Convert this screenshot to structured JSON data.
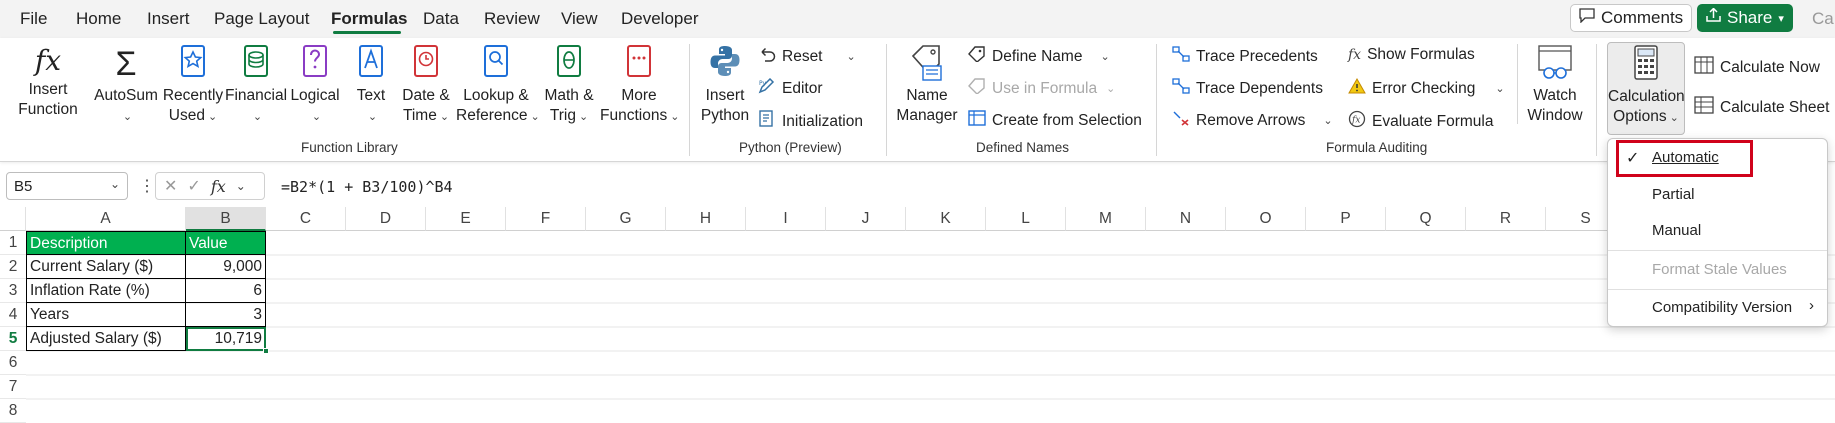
{
  "menu": {
    "tabs": [
      "File",
      "Home",
      "Insert",
      "Page Layout",
      "Formulas",
      "Data",
      "Review",
      "View",
      "Developer"
    ],
    "active_tab": "Formulas",
    "comments_label": "Comments",
    "share_label": "Share",
    "cut_text": "Ca"
  },
  "ribbon": {
    "function_library": {
      "insert_function": [
        "Insert",
        "Function"
      ],
      "autosum": "AutoSum",
      "recently_used": [
        "Recently",
        "Used"
      ],
      "financial": "Financial",
      "logical": "Logical",
      "text": "Text",
      "date_time": [
        "Date &",
        "Time"
      ],
      "lookup": [
        "Lookup &",
        "Reference"
      ],
      "math": [
        "Math &",
        "Trig"
      ],
      "more": [
        "More",
        "Functions"
      ],
      "group_label": "Function Library"
    },
    "python": {
      "insert_python": [
        "Insert",
        "Python"
      ],
      "reset": "Reset",
      "editor": "Editor",
      "initialization": "Initialization",
      "group_label": "Python (Preview)"
    },
    "defined_names": {
      "name_manager": [
        "Name",
        "Manager"
      ],
      "define_name": "Define Name",
      "use_in_formula": "Use in Formula",
      "create_from_selection": "Create from Selection",
      "group_label": "Defined Names"
    },
    "formula_auditing": {
      "trace_precedents": "Trace Precedents",
      "trace_dependents": "Trace Dependents",
      "remove_arrows": "Remove Arrows",
      "show_formulas": "Show Formulas",
      "error_checking": "Error Checking",
      "evaluate_formula": "Evaluate Formula",
      "watch_window": [
        "Watch",
        "Window"
      ],
      "group_label": "Formula Auditing"
    },
    "calculation": {
      "calc_options": [
        "Calculation",
        "Options"
      ],
      "calculate_now": "Calculate Now",
      "calculate_sheet": "Calculate Sheet"
    }
  },
  "formula_bar": {
    "name_box": "B5",
    "formula": "=B2*(1 + B3/100)^B4"
  },
  "sheet": {
    "columns": [
      "A",
      "B",
      "C",
      "D",
      "E",
      "F",
      "G",
      "H",
      "I",
      "J",
      "K",
      "L",
      "M",
      "N",
      "O",
      "P",
      "Q",
      "R",
      "S"
    ],
    "rows": [
      "1",
      "2",
      "3",
      "4",
      "5",
      "6",
      "7",
      "8"
    ],
    "selected_cell": "B5",
    "cells": [
      {
        "a": "Description",
        "b": "Value"
      },
      {
        "a": "Current Salary ($)",
        "b": "9,000"
      },
      {
        "a": "Inflation Rate (%)",
        "b": "6"
      },
      {
        "a": "Years",
        "b": "3"
      },
      {
        "a": "Adjusted Salary ($)",
        "b": "10,719"
      }
    ]
  },
  "calc_dropdown": {
    "automatic": "Automatic",
    "partial": "Partial",
    "manual": "Manual",
    "format_stale": "Format Stale Values",
    "compat": "Compatibility Version",
    "checked": "Automatic"
  },
  "colors": {
    "accent": "#107c41",
    "header_fill": "#00b050",
    "highlight": "#d0021b"
  }
}
